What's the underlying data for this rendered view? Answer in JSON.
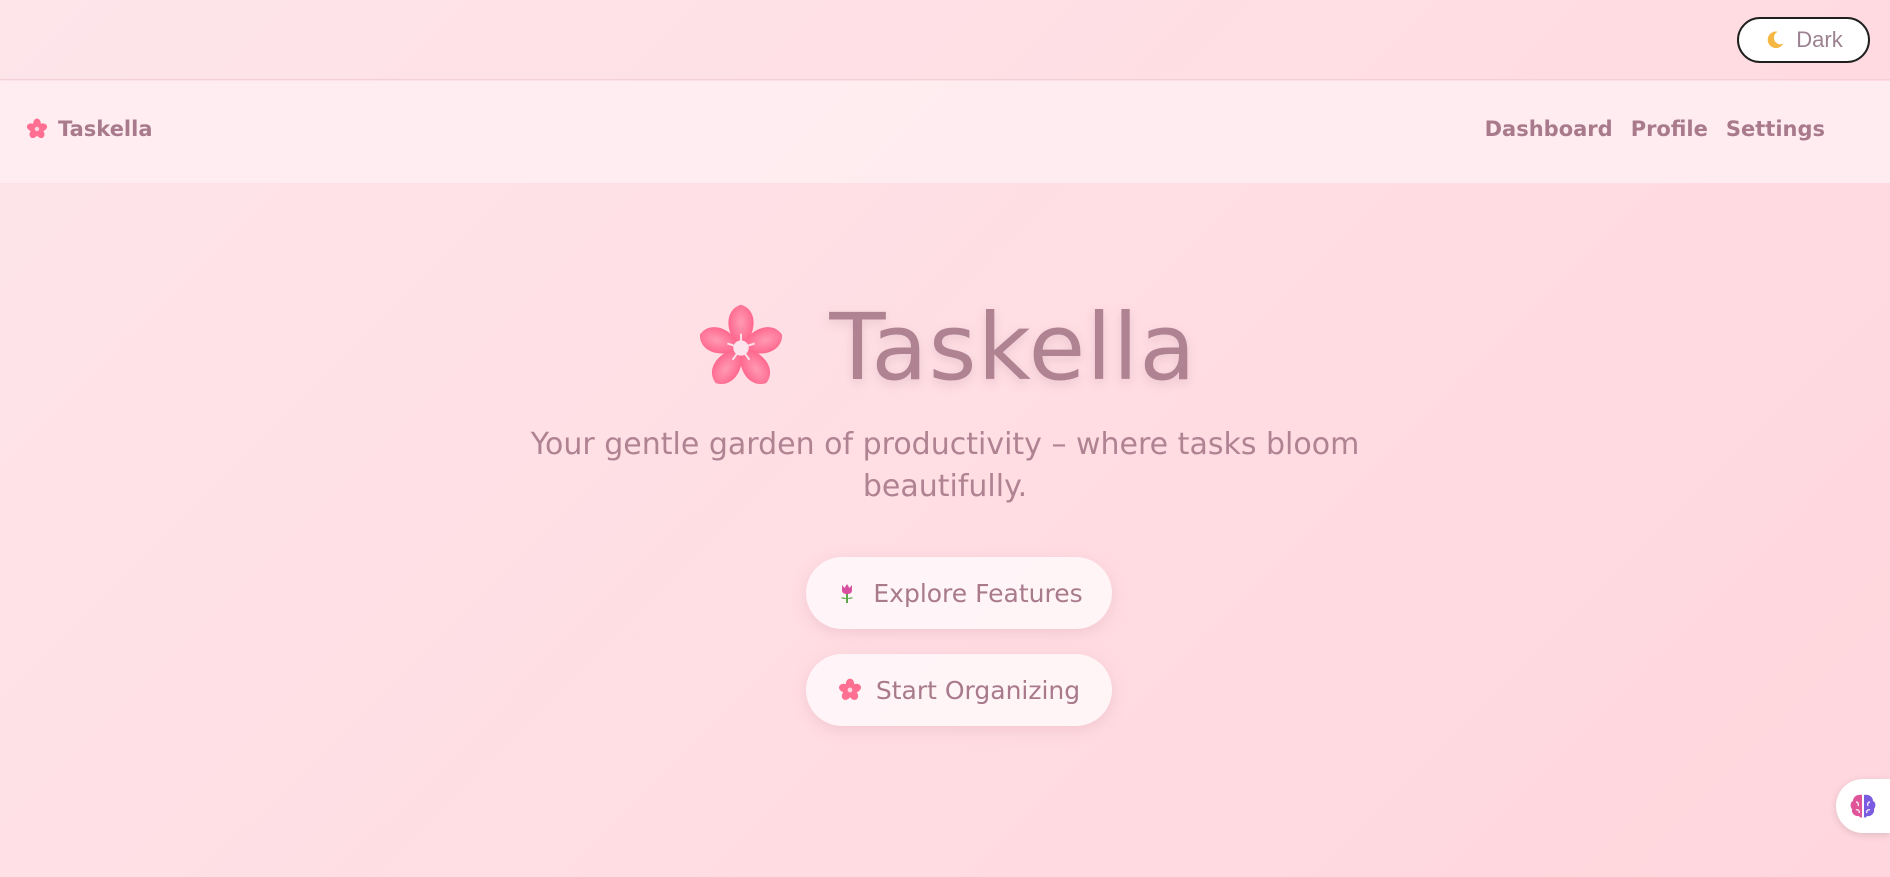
{
  "topbar": {
    "theme_toggle": {
      "label": "Dark",
      "icon": "moon-icon"
    }
  },
  "navbar": {
    "brand": {
      "name": "Taskella",
      "icon": "cherry-blossom-icon"
    },
    "links": [
      {
        "label": "Dashboard"
      },
      {
        "label": "Profile"
      },
      {
        "label": "Settings"
      }
    ]
  },
  "hero": {
    "title": "Taskella",
    "title_icon": "cherry-blossom-icon",
    "subtitle_line1": "Your gentle garden of productivity – where tasks bloom",
    "subtitle_line2": "beautifully.",
    "buttons": [
      {
        "label": "Explore Features",
        "icon": "tulip-icon"
      },
      {
        "label": "Start Organizing",
        "icon": "cherry-blossom-icon"
      }
    ]
  },
  "floating_widget": {
    "icon": "brain-icon"
  },
  "colors": {
    "background": "#ffdde3",
    "text": "#b08393",
    "accent_pink": "#ff6f91",
    "toggle_border": "#1f1f1f"
  }
}
